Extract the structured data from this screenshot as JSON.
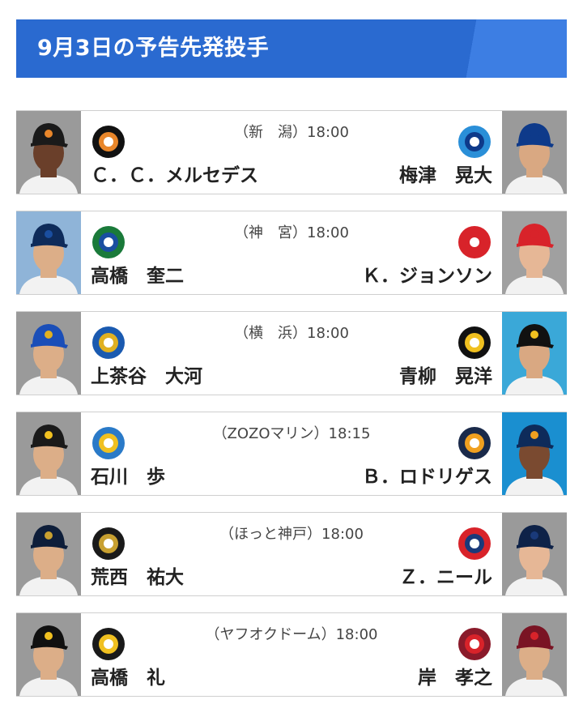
{
  "header": {
    "title": "9月3日の予告先発投手"
  },
  "games": [
    {
      "venue": "（新　潟）18:00",
      "home": {
        "pitcher": "Ｃ．Ｃ．メルセデス",
        "logo": "giants-logo",
        "logo_color": "#111111",
        "accent": "#e8862a",
        "photo_bg": "#9a9a9a",
        "cap": "#1a1a1a",
        "skin": "#6a3f2a"
      },
      "away": {
        "pitcher": "梅津　晃大",
        "logo": "dragons-logo",
        "logo_color": "#2a8fd8",
        "accent": "#0e3a8a",
        "photo_bg": "#9a9a9a",
        "cap": "#0e3a8a",
        "skin": "#d9a882"
      }
    },
    {
      "venue": "（神　宮）18:00",
      "home": {
        "pitcher": "高橋　奎二",
        "logo": "swallows-logo",
        "logo_color": "#1a7a3a",
        "accent": "#1a4ea0",
        "photo_bg": "#8fb4d8",
        "cap": "#0e2b5a",
        "skin": "#dcae88"
      },
      "away": {
        "pitcher": "Ｋ．ジョンソン",
        "logo": "carp-logo",
        "logo_color": "#d8232a",
        "accent": "#d8232a",
        "photo_bg": "#a0a0a0",
        "cap": "#d8232a",
        "skin": "#e6b796"
      }
    },
    {
      "venue": "（横　浜）18:00",
      "home": {
        "pitcher": "上茶谷　大河",
        "logo": "baystars-logo",
        "logo_color": "#1a5ab0",
        "accent": "#e0b020",
        "photo_bg": "#9a9a9a",
        "cap": "#1a4eb8",
        "skin": "#dcae88"
      },
      "away": {
        "pitcher": "青柳　晃洋",
        "logo": "tigers-logo",
        "logo_color": "#111111",
        "accent": "#f0c020",
        "photo_bg": "#3aa8d8",
        "cap": "#111111",
        "skin": "#d9a882"
      }
    },
    {
      "venue": "（ZOZOマリン）18:15",
      "home": {
        "pitcher": "石川　歩",
        "logo": "marines-logo",
        "logo_color": "#2a7ac8",
        "accent": "#f0c020",
        "photo_bg": "#9a9a9a",
        "cap": "#1a1a1a",
        "skin": "#dcae88"
      },
      "away": {
        "pitcher": "Ｂ．ロドリゲス",
        "logo": "fighters-logo",
        "logo_color": "#1a2a4a",
        "accent": "#f0a020",
        "photo_bg": "#1a8fd0",
        "cap": "#0e2b5a",
        "skin": "#7a4a30"
      }
    },
    {
      "venue": "（ほっと神戸）18:00",
      "home": {
        "pitcher": "荒西　祐大",
        "logo": "buffaloes-logo",
        "logo_color": "#1a1a1a",
        "accent": "#c8a030",
        "photo_bg": "#9a9a9a",
        "cap": "#0e1e3a",
        "skin": "#dcae88"
      },
      "away": {
        "pitcher": "Ｚ．ニール",
        "logo": "lions-logo",
        "logo_color": "#d8232a",
        "accent": "#1a3a7a",
        "photo_bg": "#9a9a9a",
        "cap": "#0e2248",
        "skin": "#e6b796"
      }
    },
    {
      "venue": "（ヤフオクドーム）18:00",
      "home": {
        "pitcher": "高橋　礼",
        "logo": "hawks-logo",
        "logo_color": "#1a1a1a",
        "accent": "#f0c020",
        "photo_bg": "#9a9a9a",
        "cap": "#111111",
        "skin": "#dcae88"
      },
      "away": {
        "pitcher": "岸　孝之",
        "logo": "eagles-logo",
        "logo_color": "#8a1a2a",
        "accent": "#d8232a",
        "photo_bg": "#9a9a9a",
        "cap": "#7a1424",
        "skin": "#dcae88"
      }
    }
  ]
}
